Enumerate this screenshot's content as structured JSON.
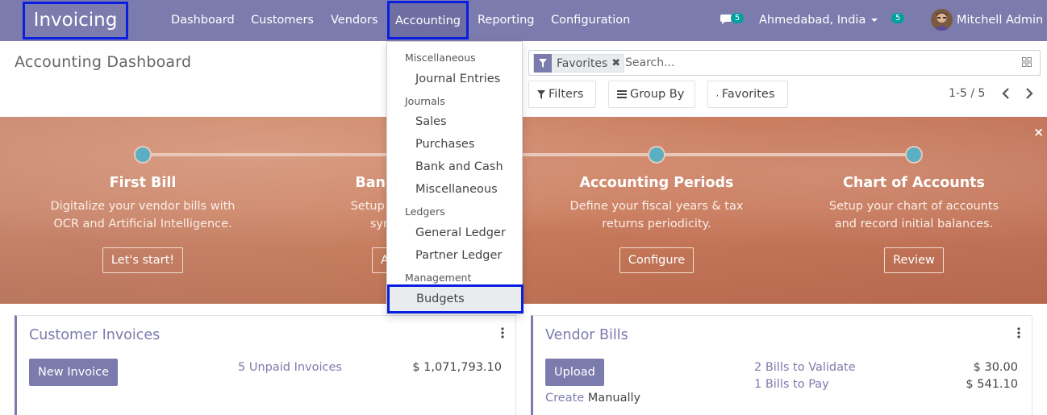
{
  "navbar": {
    "app_name": "Invoicing",
    "menu": [
      "Dashboard",
      "Customers",
      "Vendors",
      "Accounting",
      "Reporting",
      "Configuration"
    ],
    "active_menu": "Accounting",
    "chat_badge": "5",
    "company": "Ahmedabad, India",
    "activity_badge": "5",
    "user": "Mitchell Admin"
  },
  "control_panel": {
    "title": "Accounting Dashboard",
    "facet": "Favorites",
    "search_placeholder": "Search...",
    "filters_label": "Filters",
    "group_by_label": "Group By",
    "favorites_label": "Favorites",
    "pager": "1-5 / 5"
  },
  "banner": {
    "steps": [
      {
        "title": "First Bill",
        "desc1": "Digitalize your vendor bills with",
        "desc2": "OCR and Artificial Intelligence.",
        "button": "Let's start!"
      },
      {
        "title": "Bank",
        "desc1": "Setup your",
        "desc2": "sync b",
        "button": "Add"
      },
      {
        "title": "Accounting Periods",
        "desc1": "Define your fiscal years & tax",
        "desc2": "returns periodicity.",
        "button": "Configure"
      },
      {
        "title": "Chart of Accounts",
        "desc1": "Setup your chart of accounts",
        "desc2": "and record initial balances.",
        "button": "Review"
      }
    ],
    "close": "×"
  },
  "cards": {
    "customer": {
      "title": "Customer Invoices",
      "button": "New Invoice",
      "link": "5 Unpaid Invoices",
      "amount": "$ 1,071,793.10"
    },
    "vendor": {
      "title": "Vendor Bills",
      "button": "Upload",
      "create_link": "Create",
      "create_rest": "Manually",
      "link1": "2 Bills to Validate",
      "amount1": "$ 30.00",
      "link2": "1 Bills to Pay",
      "amount2": "$ 541.10"
    }
  },
  "dropdown": {
    "sections": [
      {
        "header": "Miscellaneous",
        "items": [
          "Journal Entries"
        ]
      },
      {
        "header": "Journals",
        "items": [
          "Sales",
          "Purchases",
          "Bank and Cash",
          "Miscellaneous"
        ]
      },
      {
        "header": "Ledgers",
        "items": [
          "General Ledger",
          "Partner Ledger"
        ]
      },
      {
        "header": "Management",
        "items": [
          "Budgets"
        ]
      }
    ],
    "selected_item": "Budgets"
  },
  "colors": {
    "brand": "#7c7bad",
    "highlight": "#0a1ee0",
    "badge": "#00a09d",
    "banner": "#c97a5c",
    "step_dot": "#5ab0c2"
  }
}
